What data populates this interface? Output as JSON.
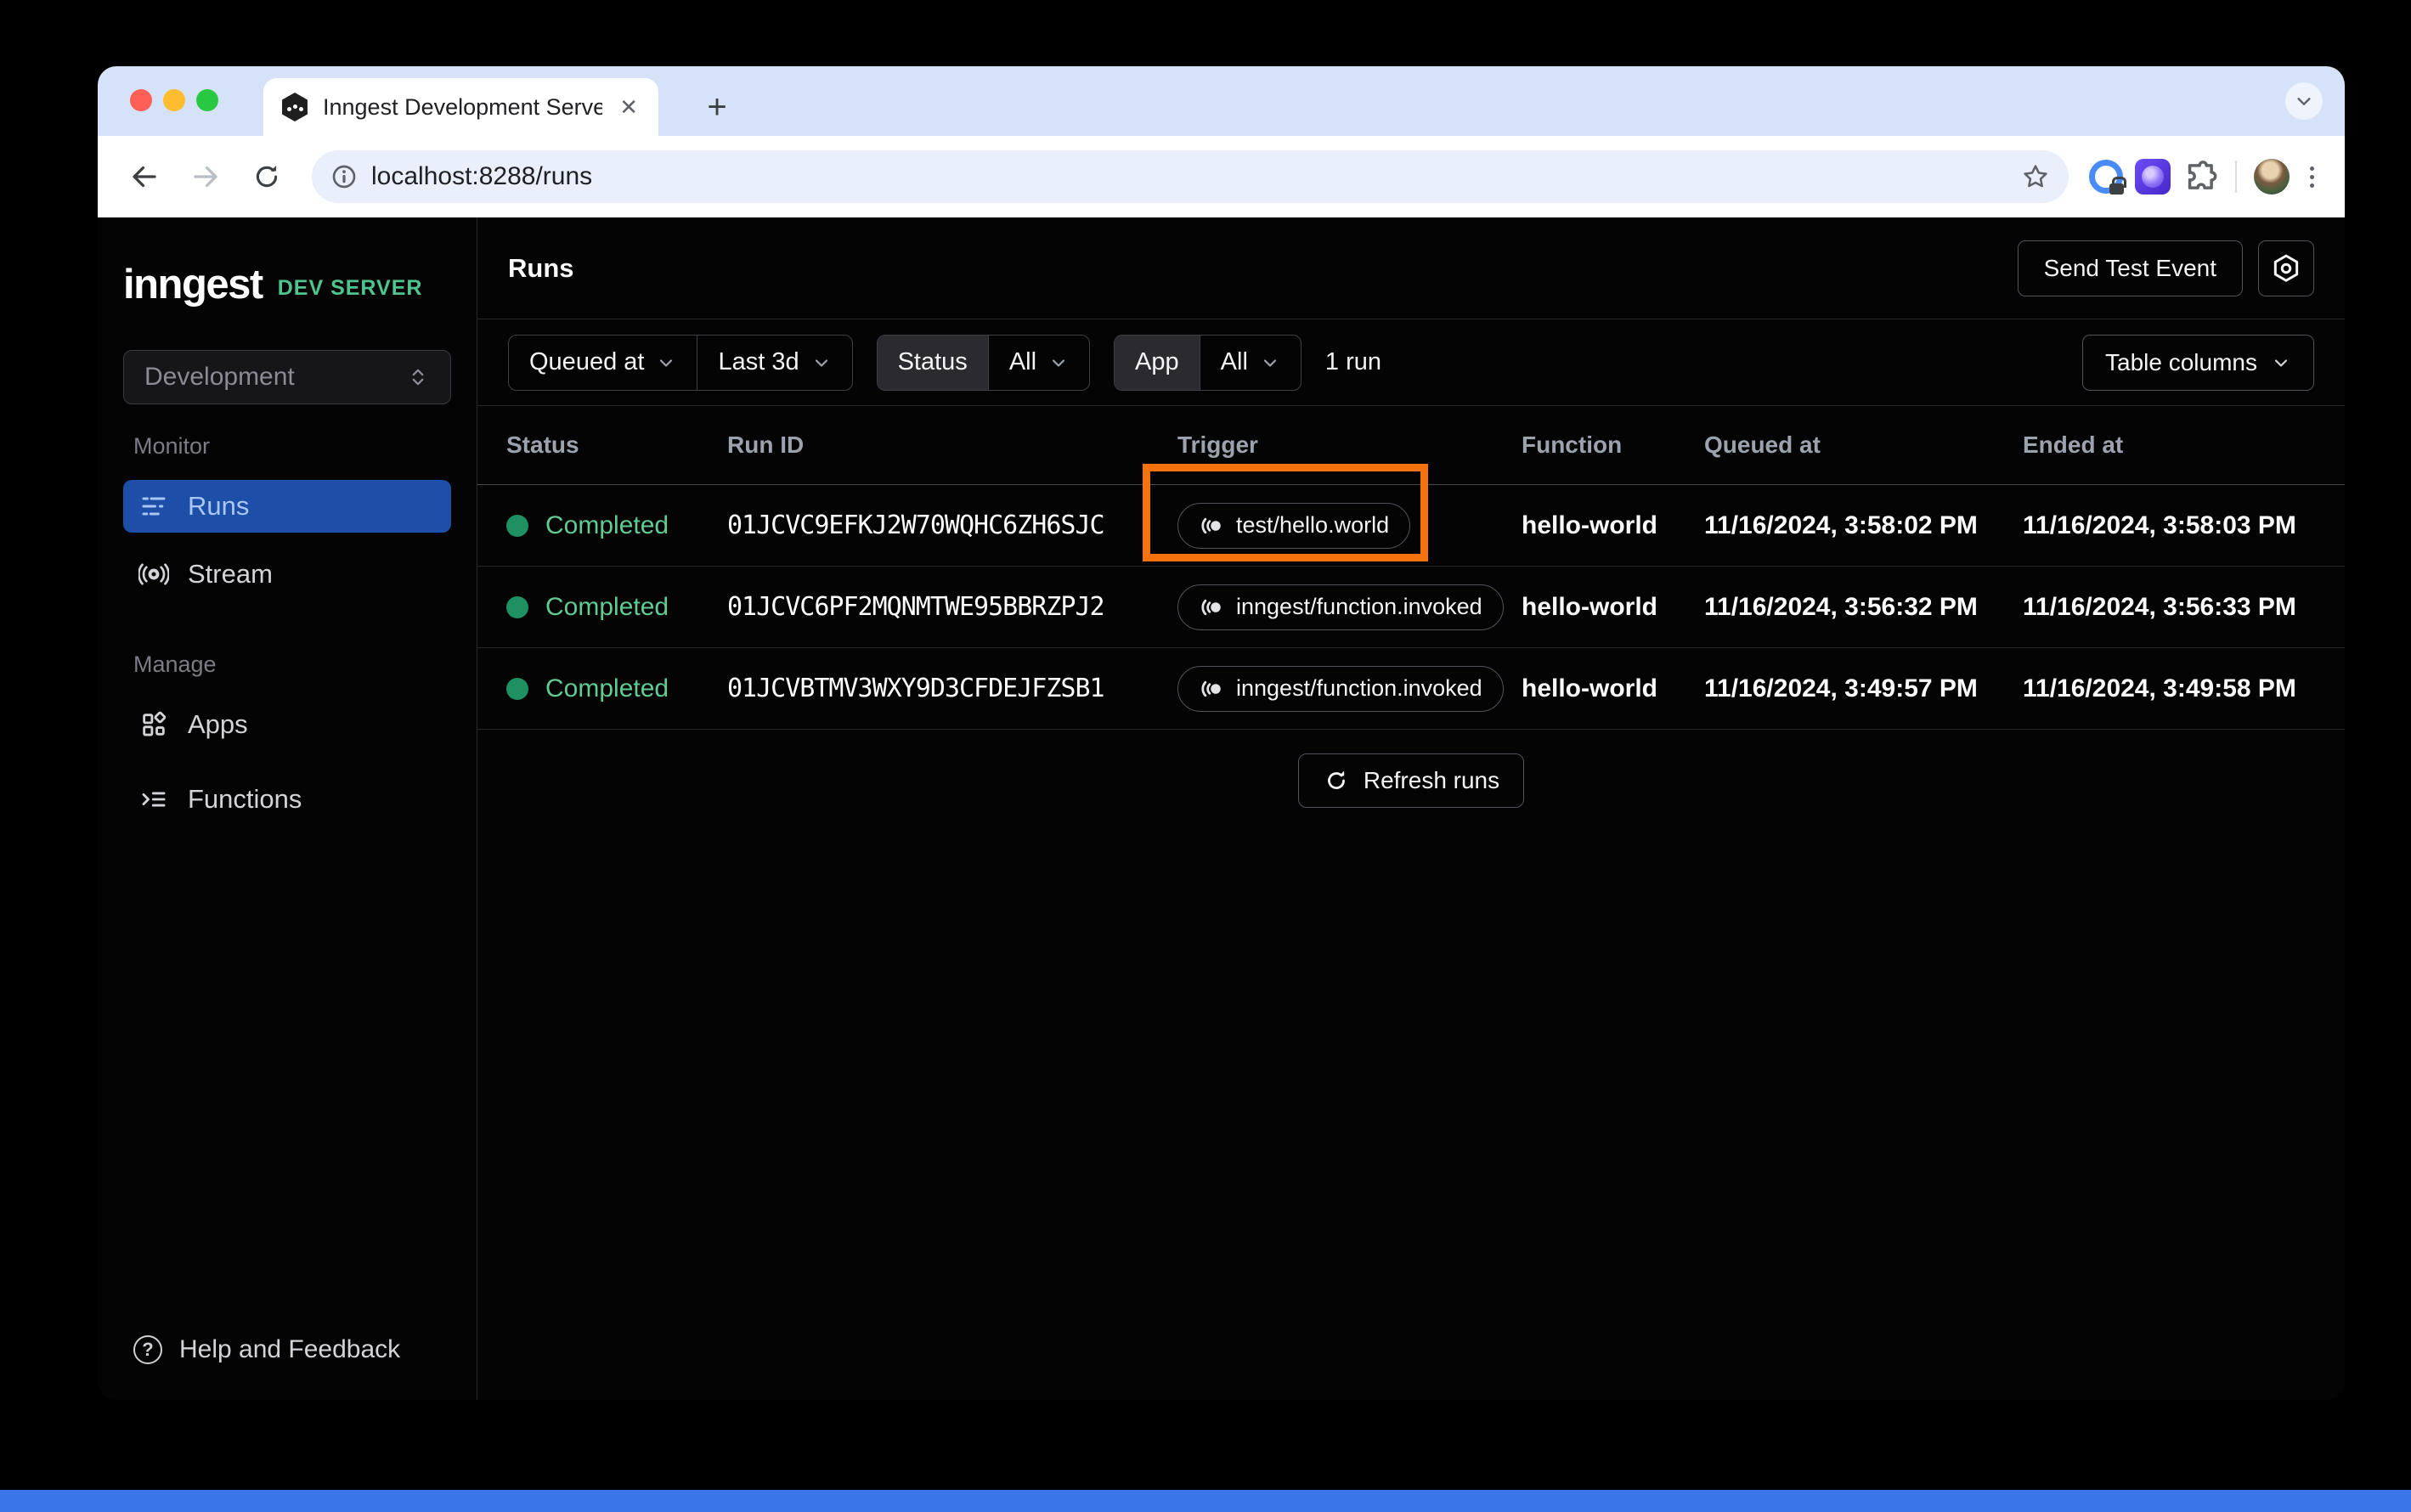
{
  "browser": {
    "tab_title": "Inngest Development Server",
    "url": "localhost:8288/runs"
  },
  "sidebar": {
    "logo": "inngest",
    "badge": "DEV SERVER",
    "environment": "Development",
    "monitor_label": "Monitor",
    "runs_label": "Runs",
    "stream_label": "Stream",
    "manage_label": "Manage",
    "apps_label": "Apps",
    "functions_label": "Functions",
    "help_label": "Help and Feedback"
  },
  "header": {
    "title": "Runs",
    "send_test_event": "Send Test Event"
  },
  "filters": {
    "queued_at": "Queued at",
    "time_range": "Last 3d",
    "status_label": "Status",
    "status_value": "All",
    "app_label": "App",
    "app_value": "All",
    "run_count": "1 run",
    "table_columns": "Table columns"
  },
  "table": {
    "headers": [
      "Status",
      "Run ID",
      "Trigger",
      "Function",
      "Queued at",
      "Ended at"
    ],
    "rows": [
      {
        "status": "Completed",
        "run_id": "01JCVC9EFKJ2W70WQHC6ZH6SJC",
        "trigger": "test/hello.world",
        "function": "hello-world",
        "queued_at": "11/16/2024, 3:58:02 PM",
        "ended_at": "11/16/2024, 3:58:03 PM"
      },
      {
        "status": "Completed",
        "run_id": "01JCVC6PF2MQNMTWE95BBRZPJ2",
        "trigger": "inngest/function.invoked",
        "function": "hello-world",
        "queued_at": "11/16/2024, 3:56:32 PM",
        "ended_at": "11/16/2024, 3:56:33 PM"
      },
      {
        "status": "Completed",
        "run_id": "01JCVBTMV3WXY9D3CFDEJFZSB1",
        "trigger": "inngest/function.invoked",
        "function": "hello-world",
        "queued_at": "11/16/2024, 3:49:57 PM",
        "ended_at": "11/16/2024, 3:49:58 PM"
      }
    ],
    "refresh_label": "Refresh runs"
  },
  "colors": {
    "accent_orange": "#f4730e",
    "active_nav_blue": "#1e4fa8",
    "status_green": "#1f9160",
    "brand_green": "#4ec58e"
  }
}
